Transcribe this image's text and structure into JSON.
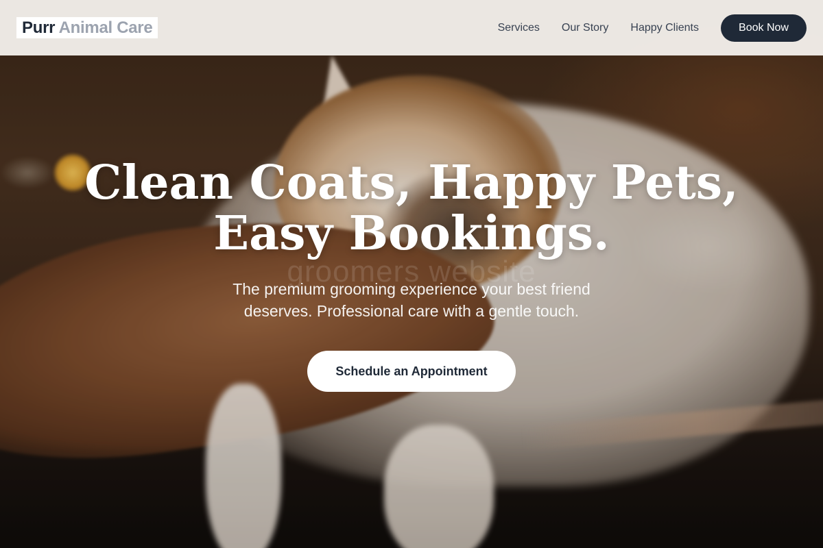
{
  "brand": {
    "name_primary": "Purr",
    "name_secondary": "Animal Care"
  },
  "nav": {
    "links": [
      {
        "label": "Services"
      },
      {
        "label": "Our Story"
      },
      {
        "label": "Happy Clients"
      }
    ],
    "cta_label": "Book Now"
  },
  "hero": {
    "headline_line1": "Clean Coats, Happy Pets,",
    "headline_line2": "Easy Bookings.",
    "watermark": "groomers website",
    "subtitle": "The premium grooming experience your best friend deserves. Professional care with a gentle touch.",
    "cta_label": "Schedule an Appointment",
    "image_subject": "cat-being-petted-photo"
  },
  "colors": {
    "primary_dark": "#1f2937",
    "muted_gray": "#9ca3af",
    "header_bg": "#f6f3ef",
    "white": "#ffffff"
  }
}
